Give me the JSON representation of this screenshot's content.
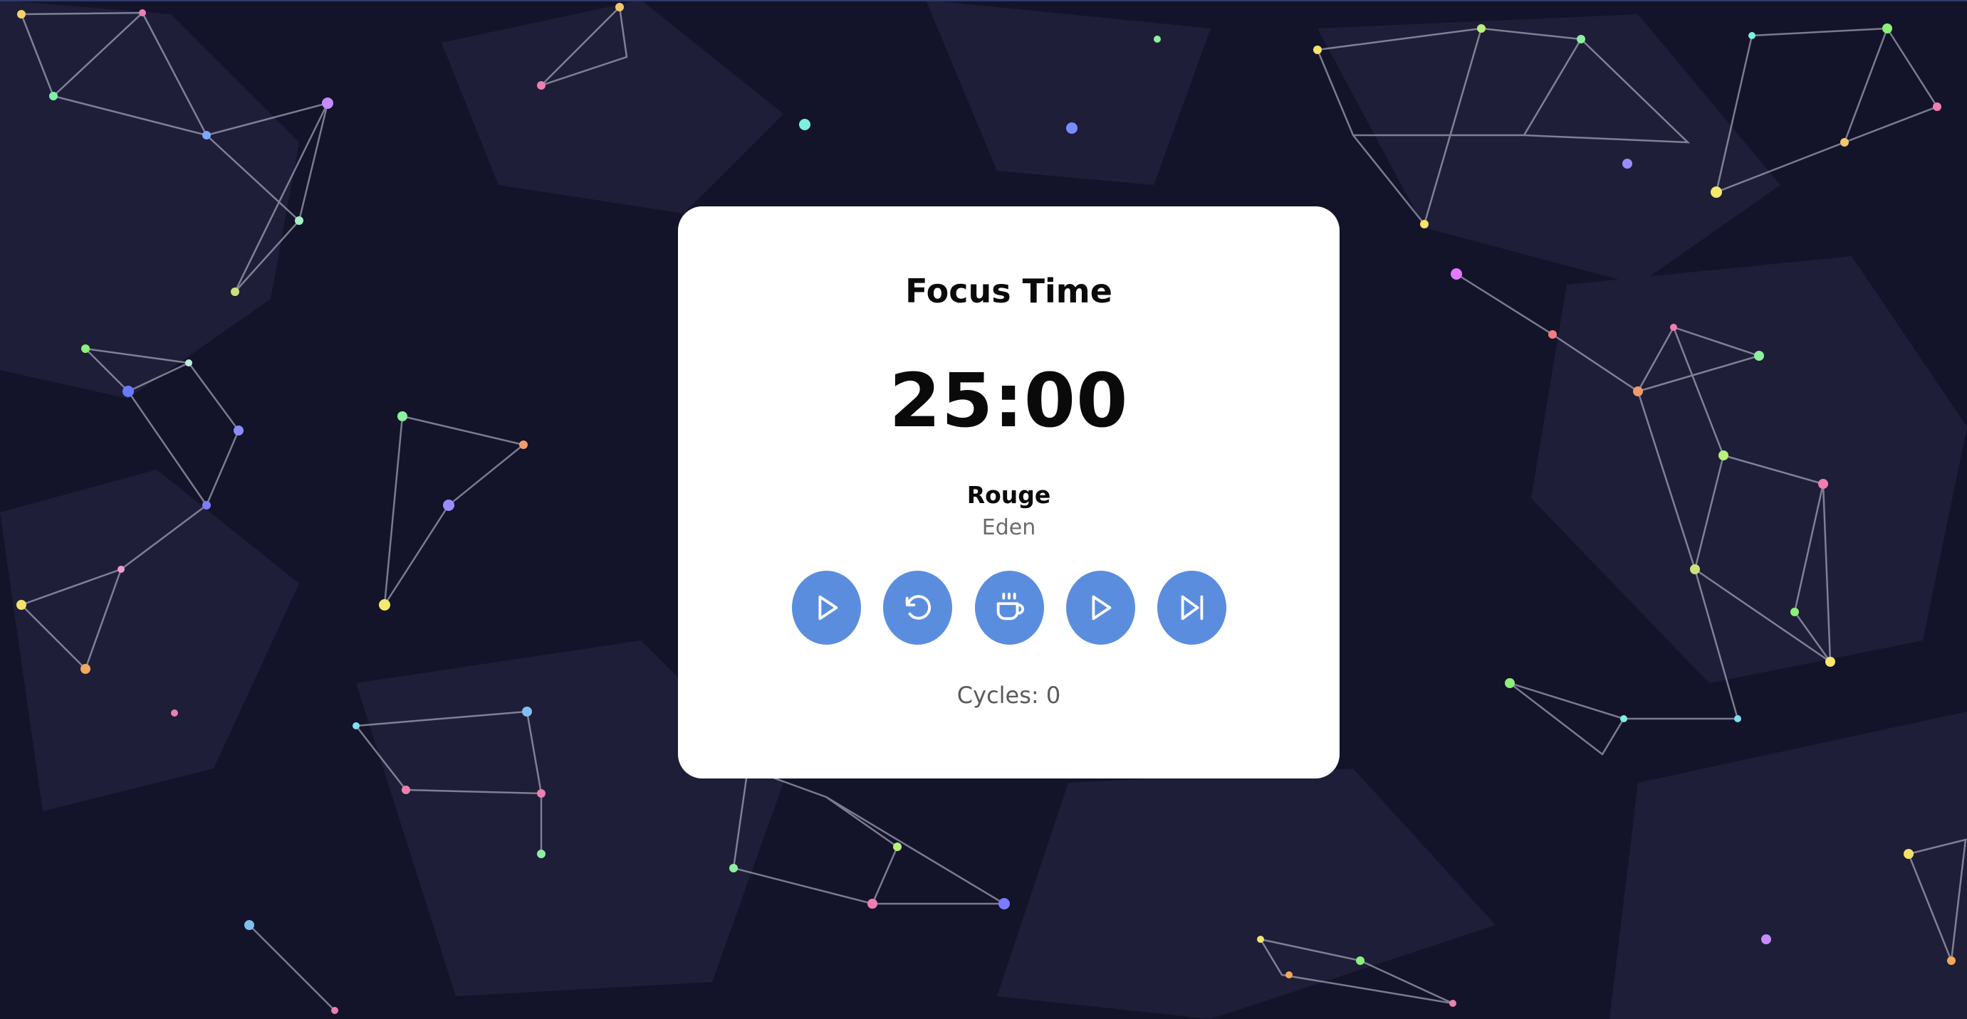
{
  "card": {
    "title": "Focus Time",
    "timer": "25:00",
    "track": {
      "title": "Rouge",
      "artist": "Eden"
    },
    "cycles_label": "Cycles: 0"
  },
  "controls": [
    {
      "icon": "play-icon"
    },
    {
      "icon": "reset-icon"
    },
    {
      "icon": "coffee-icon"
    },
    {
      "icon": "play-icon"
    },
    {
      "icon": "skip-next-icon"
    }
  ],
  "colors": {
    "background": "#13132a",
    "card": "#ffffff",
    "button": "#5b8ddf"
  }
}
